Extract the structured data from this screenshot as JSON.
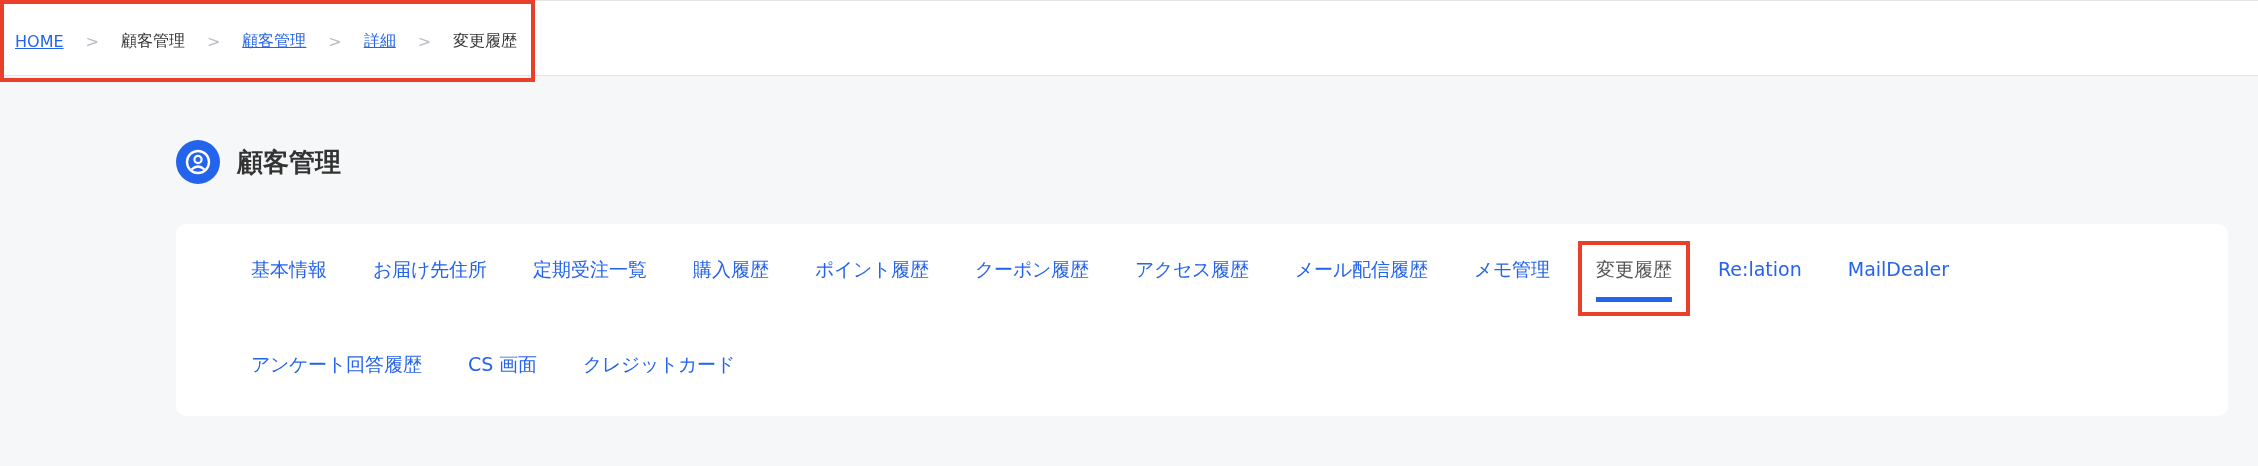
{
  "breadcrumb": {
    "highlighted": true,
    "items": [
      {
        "kind": "link",
        "label": "HOME"
      },
      {
        "kind": "separator",
        "label": ">"
      },
      {
        "kind": "text",
        "label": "顧客管理"
      },
      {
        "kind": "separator",
        "label": ">"
      },
      {
        "kind": "link",
        "label": "顧客管理"
      },
      {
        "kind": "separator",
        "label": ">"
      },
      {
        "kind": "link",
        "label": "詳細"
      },
      {
        "kind": "separator",
        "label": ">"
      },
      {
        "kind": "text",
        "label": "変更履歴"
      }
    ]
  },
  "page_title": "顧客管理",
  "tab_rows": [
    [
      {
        "label": "基本情報",
        "selected": false,
        "highlighted": false
      },
      {
        "label": "お届け先住所",
        "selected": false,
        "highlighted": false
      },
      {
        "label": "定期受注一覧",
        "selected": false,
        "highlighted": false
      },
      {
        "label": "購入履歴",
        "selected": false,
        "highlighted": false
      },
      {
        "label": "ポイント履歴",
        "selected": false,
        "highlighted": false
      },
      {
        "label": "クーポン履歴",
        "selected": false,
        "highlighted": false
      },
      {
        "label": "アクセス履歴",
        "selected": false,
        "highlighted": false
      },
      {
        "label": "メール配信履歴",
        "selected": false,
        "highlighted": false
      },
      {
        "label": "メモ管理",
        "selected": false,
        "highlighted": false
      },
      {
        "label": "変更履歴",
        "selected": true,
        "highlighted": true
      },
      {
        "label": "Re:lation",
        "selected": false,
        "highlighted": false
      },
      {
        "label": "MailDealer",
        "selected": false,
        "highlighted": false
      }
    ],
    [
      {
        "label": "アンケート回答履歴",
        "selected": false,
        "highlighted": false
      },
      {
        "label": "CS 画面",
        "selected": false,
        "highlighted": false
      },
      {
        "label": "クレジットカード",
        "selected": false,
        "highlighted": false
      }
    ]
  ]
}
